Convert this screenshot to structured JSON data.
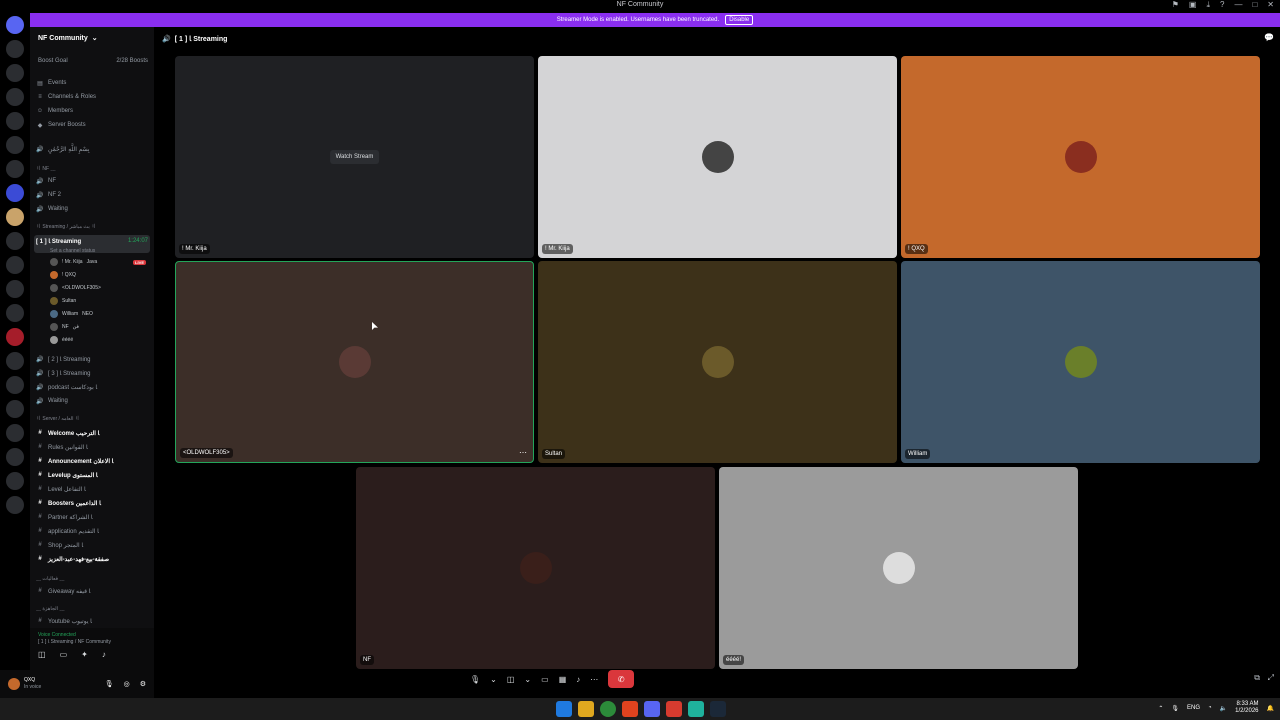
{
  "window": {
    "title": "NF Community"
  },
  "banner": {
    "text": "Streamer Mode is enabled. Usernames have been truncated.",
    "button": "Disable"
  },
  "server": {
    "name": "NF Community"
  },
  "sidebar": {
    "boost": {
      "label": "Boost Goal",
      "progress": "2/28 Boosts"
    },
    "menu": [
      "Events",
      "Channels & Roles",
      "Members",
      "Server Boosts"
    ],
    "quran": "بِسْمِ اللَّهِ الرَّحْمَٰنِ",
    "categories": [
      {
        "label": "〢 NF ﹏"
      },
      {
        "label": "〢 Streaming / بث مباشر 〢"
      },
      {
        "label": "〢 Server / العامه 〢"
      },
      {
        "label": "﹏ فعاليات ﹏"
      },
      {
        "label": "﹏ الجاهزة ﹏"
      }
    ],
    "channels_top": [
      "NF",
      "NF 2",
      "Waiting"
    ],
    "streaming_active": {
      "label": "[ 1 ] ﺎ Streaming",
      "time": "1:24:07",
      "status": "Set a channel status"
    },
    "users": [
      "! Mr. Kiija",
      "! QXQ",
      "<OLDWOLF305>",
      "Sultan",
      "William",
      "NF",
      "éééé"
    ],
    "user_tags": {
      "kiija": "Java",
      "william": "NEO",
      "nf": "فن"
    },
    "live_badge": "LIVE",
    "streaming_more": [
      "[ 2 ] ﺎ Streaming",
      "[ 3 ] ﺎ Streaming",
      "podcast ﺎ بودكاست",
      "Waiting"
    ],
    "server_channels": [
      "Welcome ﺎ الترحيب",
      "Rules ﺎ القوانين",
      "Announcement ﺎ الاعلان",
      "Levelup ﺎ المستوى",
      "Level ﺎ التفاعل",
      "Boosters ﺎ الداعمين",
      "Partner ﺎ الشراكة",
      "application ﺎ التقديم",
      "Shop ﺎ المتجر",
      "صفقة-بيع-فهد-عبد-العزيز"
    ],
    "events_channels": [
      "Giveaway ﺎ قيفه",
      "Youtube ﺎ يوتيوب"
    ]
  },
  "voice": {
    "status": "Voice Connected",
    "channel": "[ 1 ] ﺎ Streaming / NF Community"
  },
  "me": {
    "name": "QXQ",
    "status": "In voice"
  },
  "stage": {
    "channel": "[ 1 ] ﺎ Streaming",
    "watch_label": "Watch Stream",
    "tiles": [
      {
        "name": "! Mr. Kiija",
        "color": "#1f2023"
      },
      {
        "name": "! Mr. Kiija",
        "color": "#d4d4d6"
      },
      {
        "name": "! QXQ",
        "color": "#c4692c"
      },
      {
        "name": "<OLDWOLF305>",
        "color": "#3c2e28"
      },
      {
        "name": "Sultan",
        "color": "#3d3119"
      },
      {
        "name": "William",
        "color": "#3e5468"
      },
      {
        "name": "NF",
        "color": "#2b1d1c"
      },
      {
        "name": "éééé!",
        "color": "#9b9b9b"
      }
    ]
  },
  "taskbar": {
    "lang": "ENG",
    "time": "8:33 AM",
    "date": "1/2/2026"
  }
}
